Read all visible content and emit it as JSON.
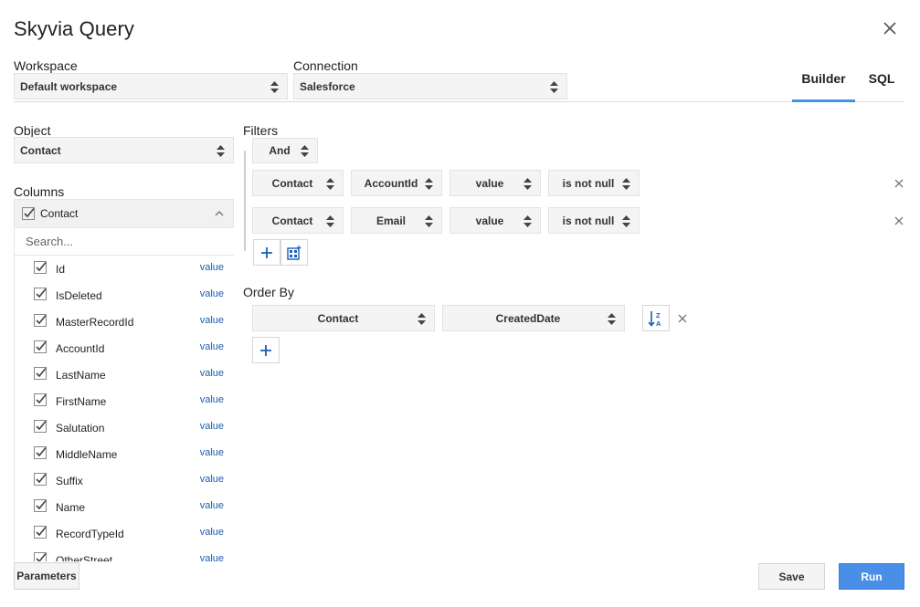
{
  "window": {
    "title": "Skyvia Query"
  },
  "workspace": {
    "label": "Workspace",
    "value": "Default workspace"
  },
  "connection": {
    "label": "Connection",
    "value": "Salesforce"
  },
  "tabs": [
    {
      "label": "Builder",
      "active": true
    },
    {
      "label": "SQL",
      "active": false
    }
  ],
  "object": {
    "label": "Object",
    "value": "Contact"
  },
  "columns": {
    "label": "Columns",
    "group": "Contact",
    "search_placeholder": "Search...",
    "value_link": "value",
    "items": [
      {
        "name": "Id"
      },
      {
        "name": "IsDeleted"
      },
      {
        "name": "MasterRecordId"
      },
      {
        "name": "AccountId"
      },
      {
        "name": "LastName"
      },
      {
        "name": "FirstName"
      },
      {
        "name": "Salutation"
      },
      {
        "name": "MiddleName"
      },
      {
        "name": "Suffix"
      },
      {
        "name": "Name"
      },
      {
        "name": "RecordTypeId"
      },
      {
        "name": "OtherStreet"
      }
    ]
  },
  "filters": {
    "label": "Filters",
    "logic": "And",
    "rows": [
      {
        "object": "Contact",
        "field": "AccountId",
        "type": "value",
        "operator": "is not null"
      },
      {
        "object": "Contact",
        "field": "Email",
        "type": "value",
        "operator": "is not null"
      }
    ]
  },
  "order_by": {
    "label": "Order By",
    "rows": [
      {
        "object": "Contact",
        "field": "CreatedDate",
        "direction": "sort-desc-z-a"
      }
    ]
  },
  "footer": {
    "parameters_label": "Parameters",
    "save_label": "Save",
    "run_label": "Run"
  },
  "colors": {
    "accent": "#4a8fe7",
    "link": "#1a5fb4"
  }
}
